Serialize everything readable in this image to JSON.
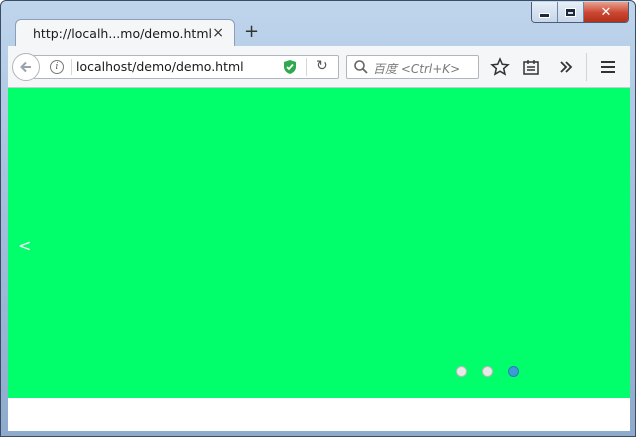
{
  "window": {
    "controls": [
      "minimize",
      "maximize",
      "close"
    ]
  },
  "tab": {
    "title": "http://localh...mo/demo.html",
    "close_glyph": "×",
    "new_tab_glyph": "+"
  },
  "toolbar": {
    "url": "localhost/demo/demo.html",
    "search_placeholder": "百度 <Ctrl+K>",
    "icons": [
      "back-icon",
      "info-icon",
      "shield-icon",
      "reload-icon",
      "search-icon",
      "bookmark-star-icon",
      "reading-list-icon",
      "overflow-chevron-icon",
      "menu-icon"
    ],
    "accent_color": "#2fa84f"
  },
  "carousel": {
    "background": "#00ff6a",
    "prev_glyph": "<",
    "dot_count": 3,
    "active_dot": 3,
    "active_color": "#3d9bd6"
  }
}
